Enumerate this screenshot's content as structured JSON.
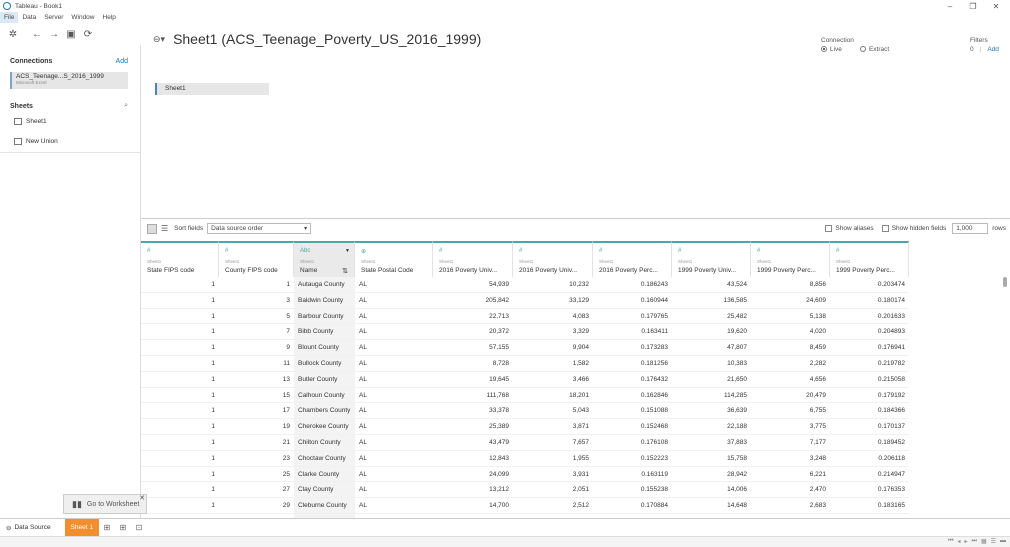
{
  "window": {
    "title": "Tableau - Book1"
  },
  "menu": [
    "File",
    "Data",
    "Server",
    "Window",
    "Help"
  ],
  "left": {
    "connections_title": "Connections",
    "add_label": "Add",
    "connection_name": "ACS_Teenage...S_2016_1999",
    "connection_type": "Microsoft Excel",
    "sheets_title": "Sheets",
    "sheet_item": "Sheet1",
    "new_union": "New Union"
  },
  "canvas": {
    "title": "Sheet1 (ACS_Teenage_Poverty_US_2016_1999)",
    "connection_label": "Connection",
    "live_label": "Live",
    "extract_label": "Extract",
    "filters_label": "Filters",
    "filters_count": "0",
    "filters_add": "Add",
    "table_pill": "Sheet1"
  },
  "grid_tools": {
    "sort_label": "Sort fields",
    "sort_value": "Data source order",
    "show_aliases": "Show aliases",
    "show_hidden": "Show hidden fields",
    "rows_value": "1,000",
    "rows_label": "rows"
  },
  "columns": [
    {
      "icon": "#",
      "source": "Sheet1",
      "name": "State FIPS code"
    },
    {
      "icon": "#",
      "source": "Sheet1",
      "name": "County FIPS code"
    },
    {
      "icon": "Abc",
      "source": "Sheet1",
      "name": "Name"
    },
    {
      "icon": "⊕",
      "source": "Sheet1",
      "name": "State Postal Code"
    },
    {
      "icon": "#",
      "source": "Sheet1",
      "name": "2016 Poverty Univ..."
    },
    {
      "icon": "#",
      "source": "Sheet1",
      "name": "2016 Poverty Univ..."
    },
    {
      "icon": "#",
      "source": "Sheet1",
      "name": "2016 Poverty Perc..."
    },
    {
      "icon": "#",
      "source": "Sheet1",
      "name": "1999 Poverty Univ..."
    },
    {
      "icon": "#",
      "source": "Sheet1",
      "name": "1999 Poverty Perc..."
    },
    {
      "icon": "#",
      "source": "Sheet1",
      "name": "1999 Poverty Perc..."
    }
  ],
  "rows": [
    [
      "1",
      "1",
      "Autauga County",
      "AL",
      "54,939",
      "10,232",
      "0.186243",
      "43,524",
      "8,856",
      "0.203474"
    ],
    [
      "1",
      "3",
      "Baldwin County",
      "AL",
      "205,842",
      "33,129",
      "0.160944",
      "136,585",
      "24,609",
      "0.180174"
    ],
    [
      "1",
      "5",
      "Barbour County",
      "AL",
      "22,713",
      "4,083",
      "0.179765",
      "25,482",
      "5,138",
      "0.201633"
    ],
    [
      "1",
      "7",
      "Bibb County",
      "AL",
      "20,372",
      "3,329",
      "0.163411",
      "19,620",
      "4,020",
      "0.204893"
    ],
    [
      "1",
      "9",
      "Blount County",
      "AL",
      "57,155",
      "9,904",
      "0.173283",
      "47,807",
      "8,459",
      "0.176941"
    ],
    [
      "1",
      "11",
      "Bullock County",
      "AL",
      "8,728",
      "1,582",
      "0.181256",
      "10,383",
      "2,282",
      "0.219782"
    ],
    [
      "1",
      "13",
      "Butler County",
      "AL",
      "19,645",
      "3,466",
      "0.176432",
      "21,650",
      "4,656",
      "0.215058"
    ],
    [
      "1",
      "15",
      "Calhoun County",
      "AL",
      "111,768",
      "18,201",
      "0.162846",
      "114,285",
      "20,479",
      "0.179192"
    ],
    [
      "1",
      "17",
      "Chambers County",
      "AL",
      "33,378",
      "5,043",
      "0.151088",
      "36,639",
      "6,755",
      "0.184366"
    ],
    [
      "1",
      "19",
      "Cherokee County",
      "AL",
      "25,389",
      "3,871",
      "0.152468",
      "22,188",
      "3,775",
      "0.170137"
    ],
    [
      "1",
      "21",
      "Chilton County",
      "AL",
      "43,479",
      "7,657",
      "0.176108",
      "37,883",
      "7,177",
      "0.189452"
    ],
    [
      "1",
      "23",
      "Choctaw County",
      "AL",
      "12,843",
      "1,955",
      "0.152223",
      "15,758",
      "3,248",
      "0.206118"
    ],
    [
      "1",
      "25",
      "Clarke County",
      "AL",
      "24,099",
      "3,931",
      "0.163119",
      "28,942",
      "6,221",
      "0.214947"
    ],
    [
      "1",
      "27",
      "Clay County",
      "AL",
      "13,212",
      "2,051",
      "0.155238",
      "14,006",
      "2,470",
      "0.176353"
    ],
    [
      "1",
      "29",
      "Cleburne County",
      "AL",
      "14,700",
      "2,512",
      "0.170884",
      "14,648",
      "2,683",
      "0.183165"
    ]
  ],
  "goto": {
    "label": "Go to Worksheet"
  },
  "bottom": {
    "data_source_tab": "Data Source",
    "sheet_tab": "Sheet 1"
  }
}
